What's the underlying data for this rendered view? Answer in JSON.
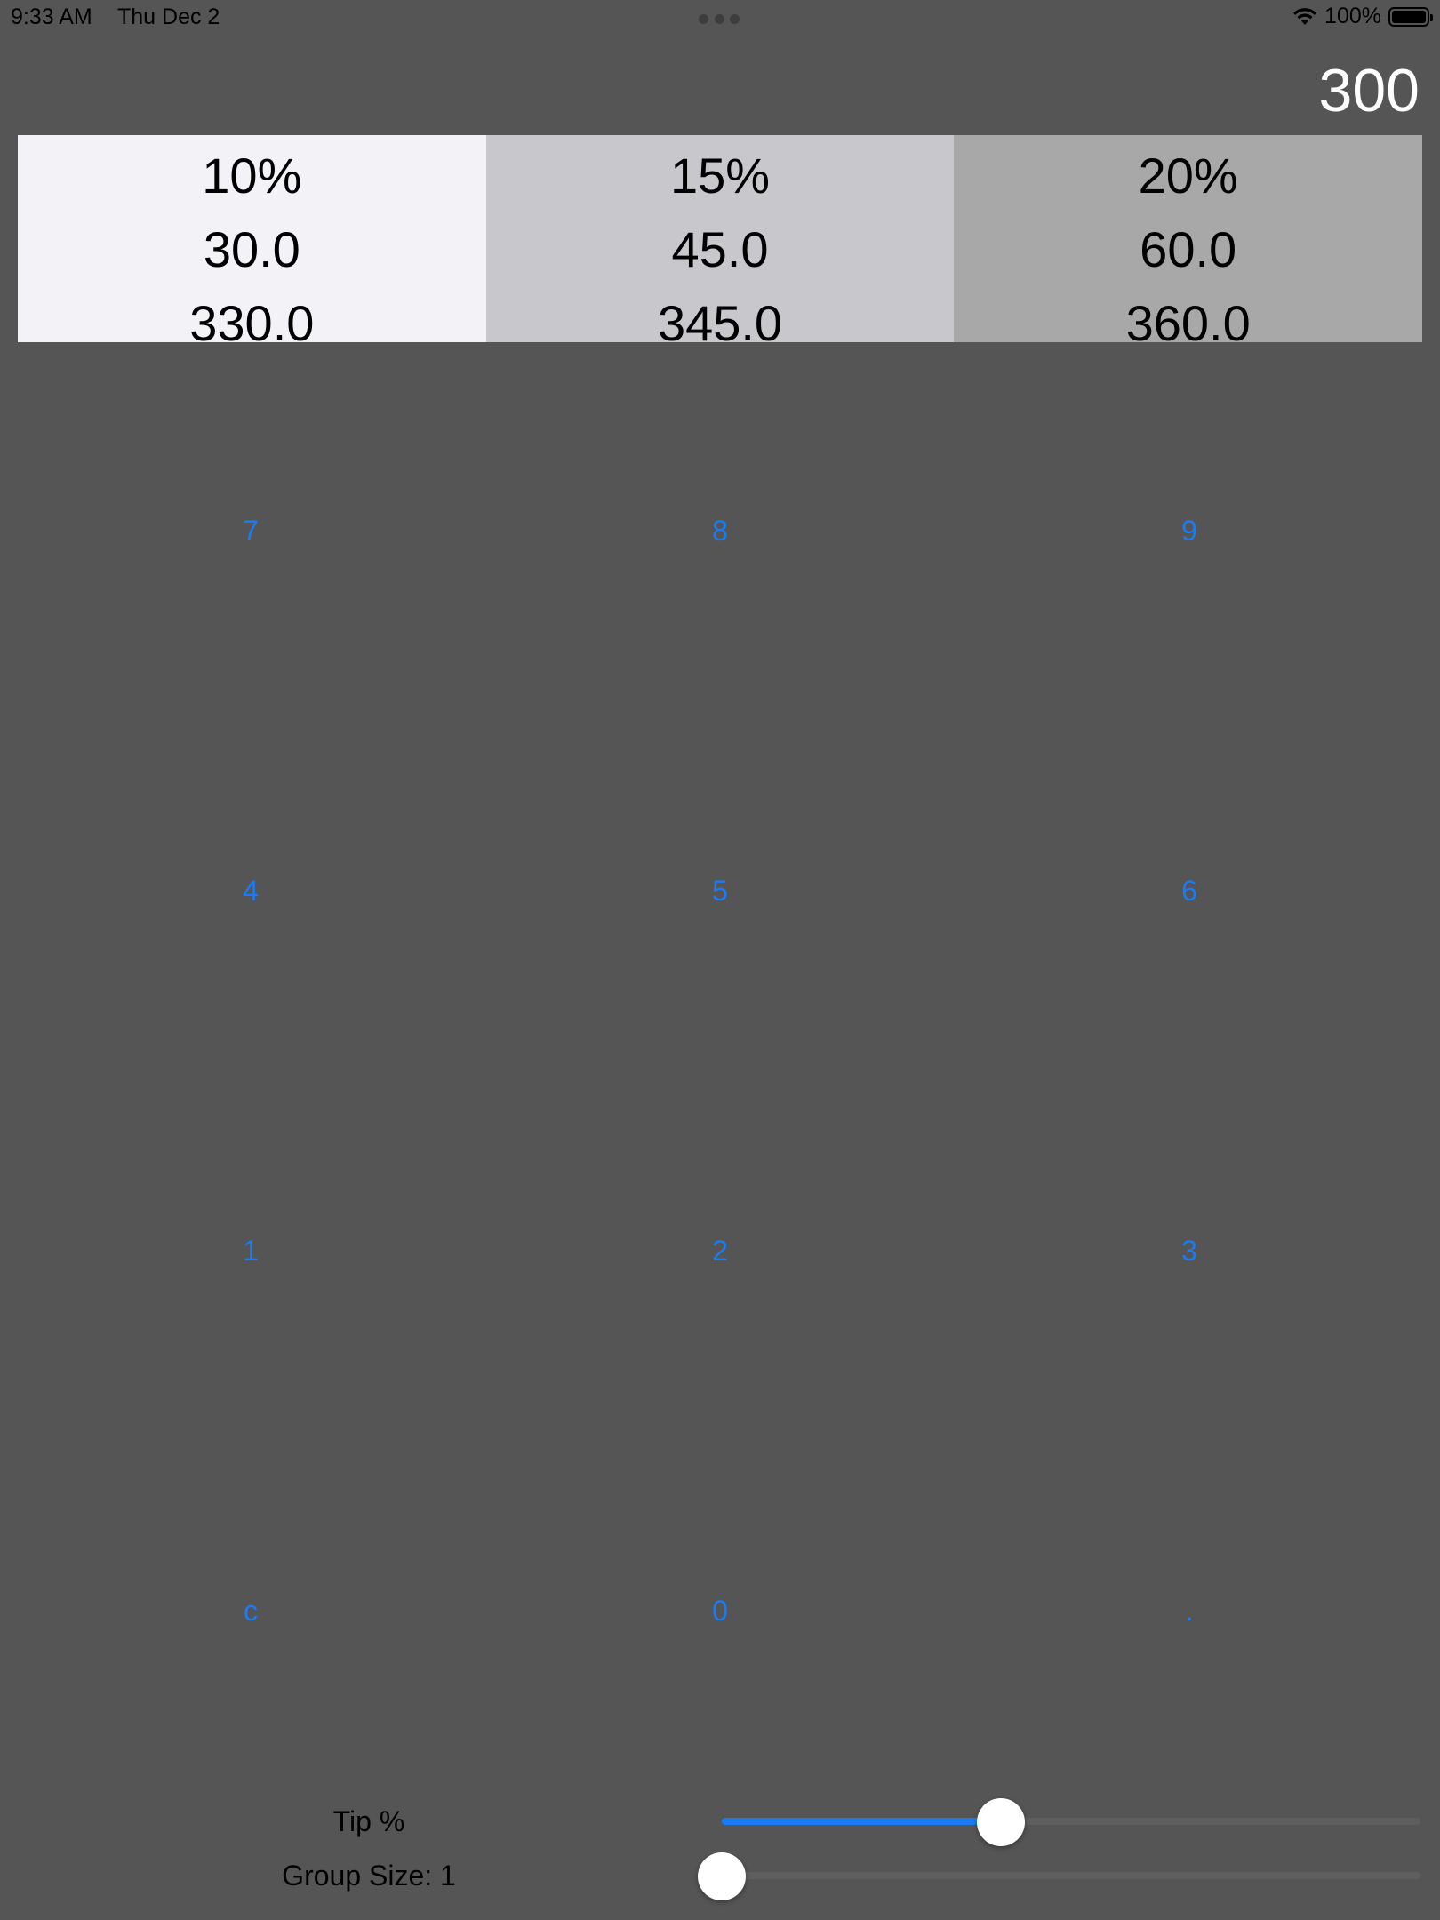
{
  "status_bar": {
    "time": "9:33 AM",
    "date": "Thu Dec 2",
    "battery": "100%",
    "icons": [
      "wifi-icon",
      "battery-icon",
      "multitask-dots-icon"
    ]
  },
  "amount": "300",
  "tips": [
    {
      "percent": "10%",
      "tip": "30.0",
      "total": "330.0",
      "color": "#f2f2f7"
    },
    {
      "percent": "15%",
      "tip": "45.0",
      "total": "345.0",
      "color": "#c8c8cc"
    },
    {
      "percent": "20%",
      "tip": "60.0",
      "total": "360.0",
      "color": "#a8a8a8"
    }
  ],
  "keypad": {
    "keys": [
      "7",
      "8",
      "9",
      "4",
      "5",
      "6",
      "1",
      "2",
      "3",
      "c",
      "0",
      "."
    ]
  },
  "sliders": {
    "tip": {
      "label": "Tip %",
      "fraction": 0.4
    },
    "group": {
      "label": "Group Size: 1",
      "fraction": 0.0
    }
  },
  "colors": {
    "background": "#555555",
    "accent": "#1a7cf5",
    "text_light": "#ffffff"
  }
}
